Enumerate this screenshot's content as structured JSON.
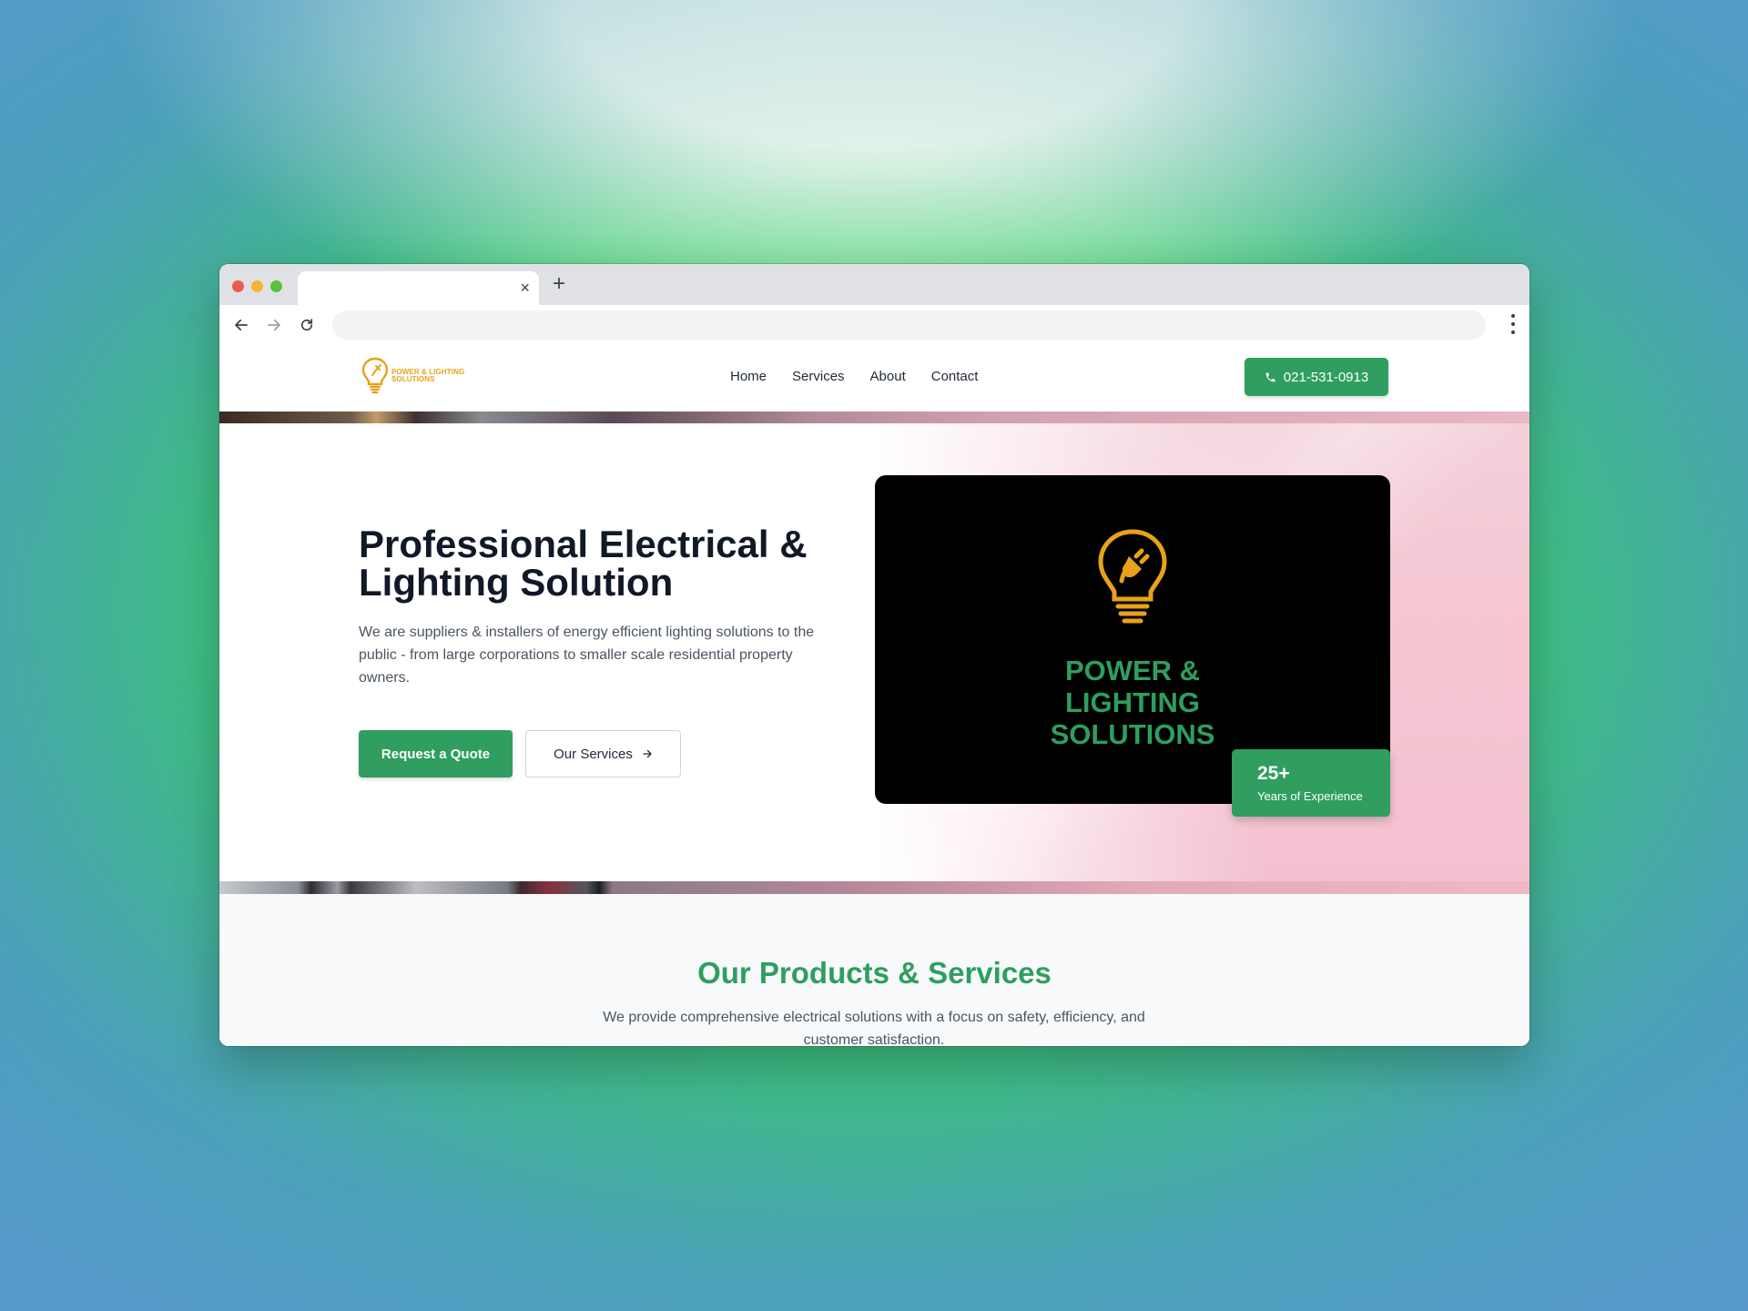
{
  "browser": {
    "tab_close": "×",
    "new_tab": "+"
  },
  "site": {
    "logo_text_line1": "POWER & LIGHTING",
    "logo_text_line2": "SOLUTIONS",
    "nav": [
      "Home",
      "Services",
      "About",
      "Contact"
    ],
    "phone": "021-531-0913"
  },
  "hero": {
    "title": "Professional Electrical & Lighting Solution",
    "description": "We are suppliers & installers of energy efficient lighting solutions to the public - from large corporations to smaller scale residential property owners.",
    "primary_button": "Request a Quote",
    "secondary_button": "Our Services",
    "card_text_line1": "POWER &",
    "card_text_line2": "LIGHTING",
    "card_text_line3": "SOLUTIONS",
    "experience_number": "25+",
    "experience_label": "Years of Experience"
  },
  "products": {
    "title": "Our Products & Services",
    "description": "We provide comprehensive electrical solutions with a focus on safety, efficiency, and customer satisfaction."
  },
  "colors": {
    "brand_green": "#2f9e5f",
    "logo_orange": "#e8a21a"
  }
}
